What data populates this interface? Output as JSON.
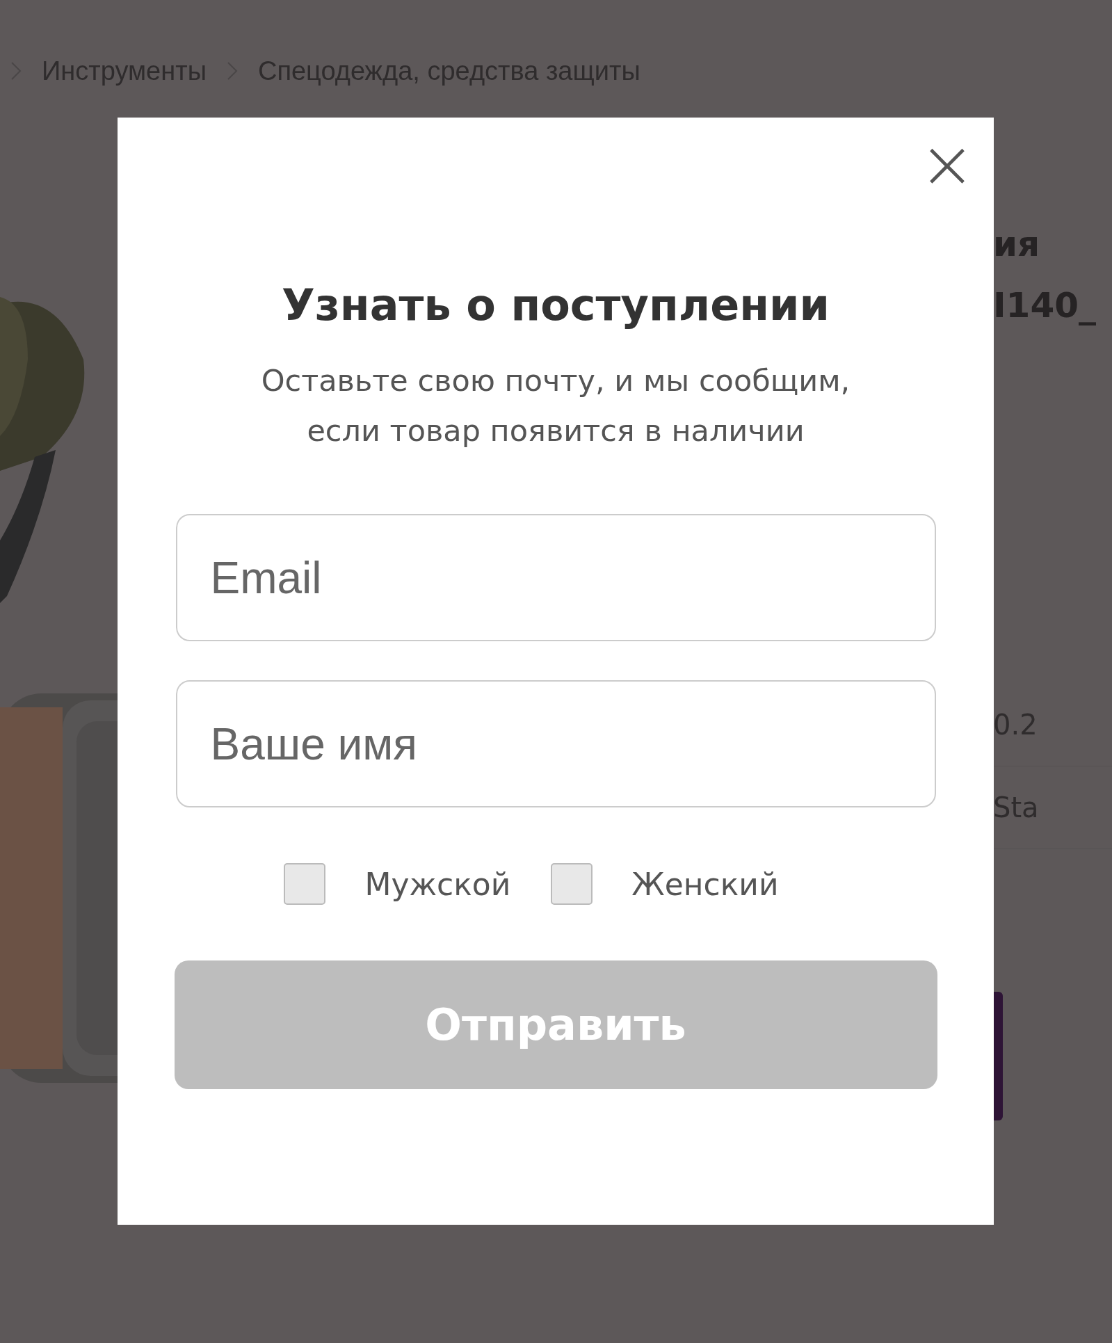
{
  "breadcrumbs": [
    {
      "label": "Инструменты"
    },
    {
      "label": "Спецодежда, средства защиты"
    }
  ],
  "product_title_lines": [
    "ия",
    "I140_"
  ],
  "spec_values": [
    "0.2",
    "Sta"
  ],
  "modal": {
    "close": "×",
    "title": "Узнать о поступлении",
    "subtitle": "Оставьте свою почту, и мы сообщим, если товар появится в наличии",
    "fields": [
      {
        "placeholder": "Email"
      },
      {
        "placeholder": "Ваше имя"
      }
    ],
    "gender_options": [
      {
        "label": "Мужской",
        "checked": false
      },
      {
        "label": "Женский",
        "checked": false
      }
    ],
    "submit": {
      "label": "Отправить",
      "disabled": true
    }
  }
}
